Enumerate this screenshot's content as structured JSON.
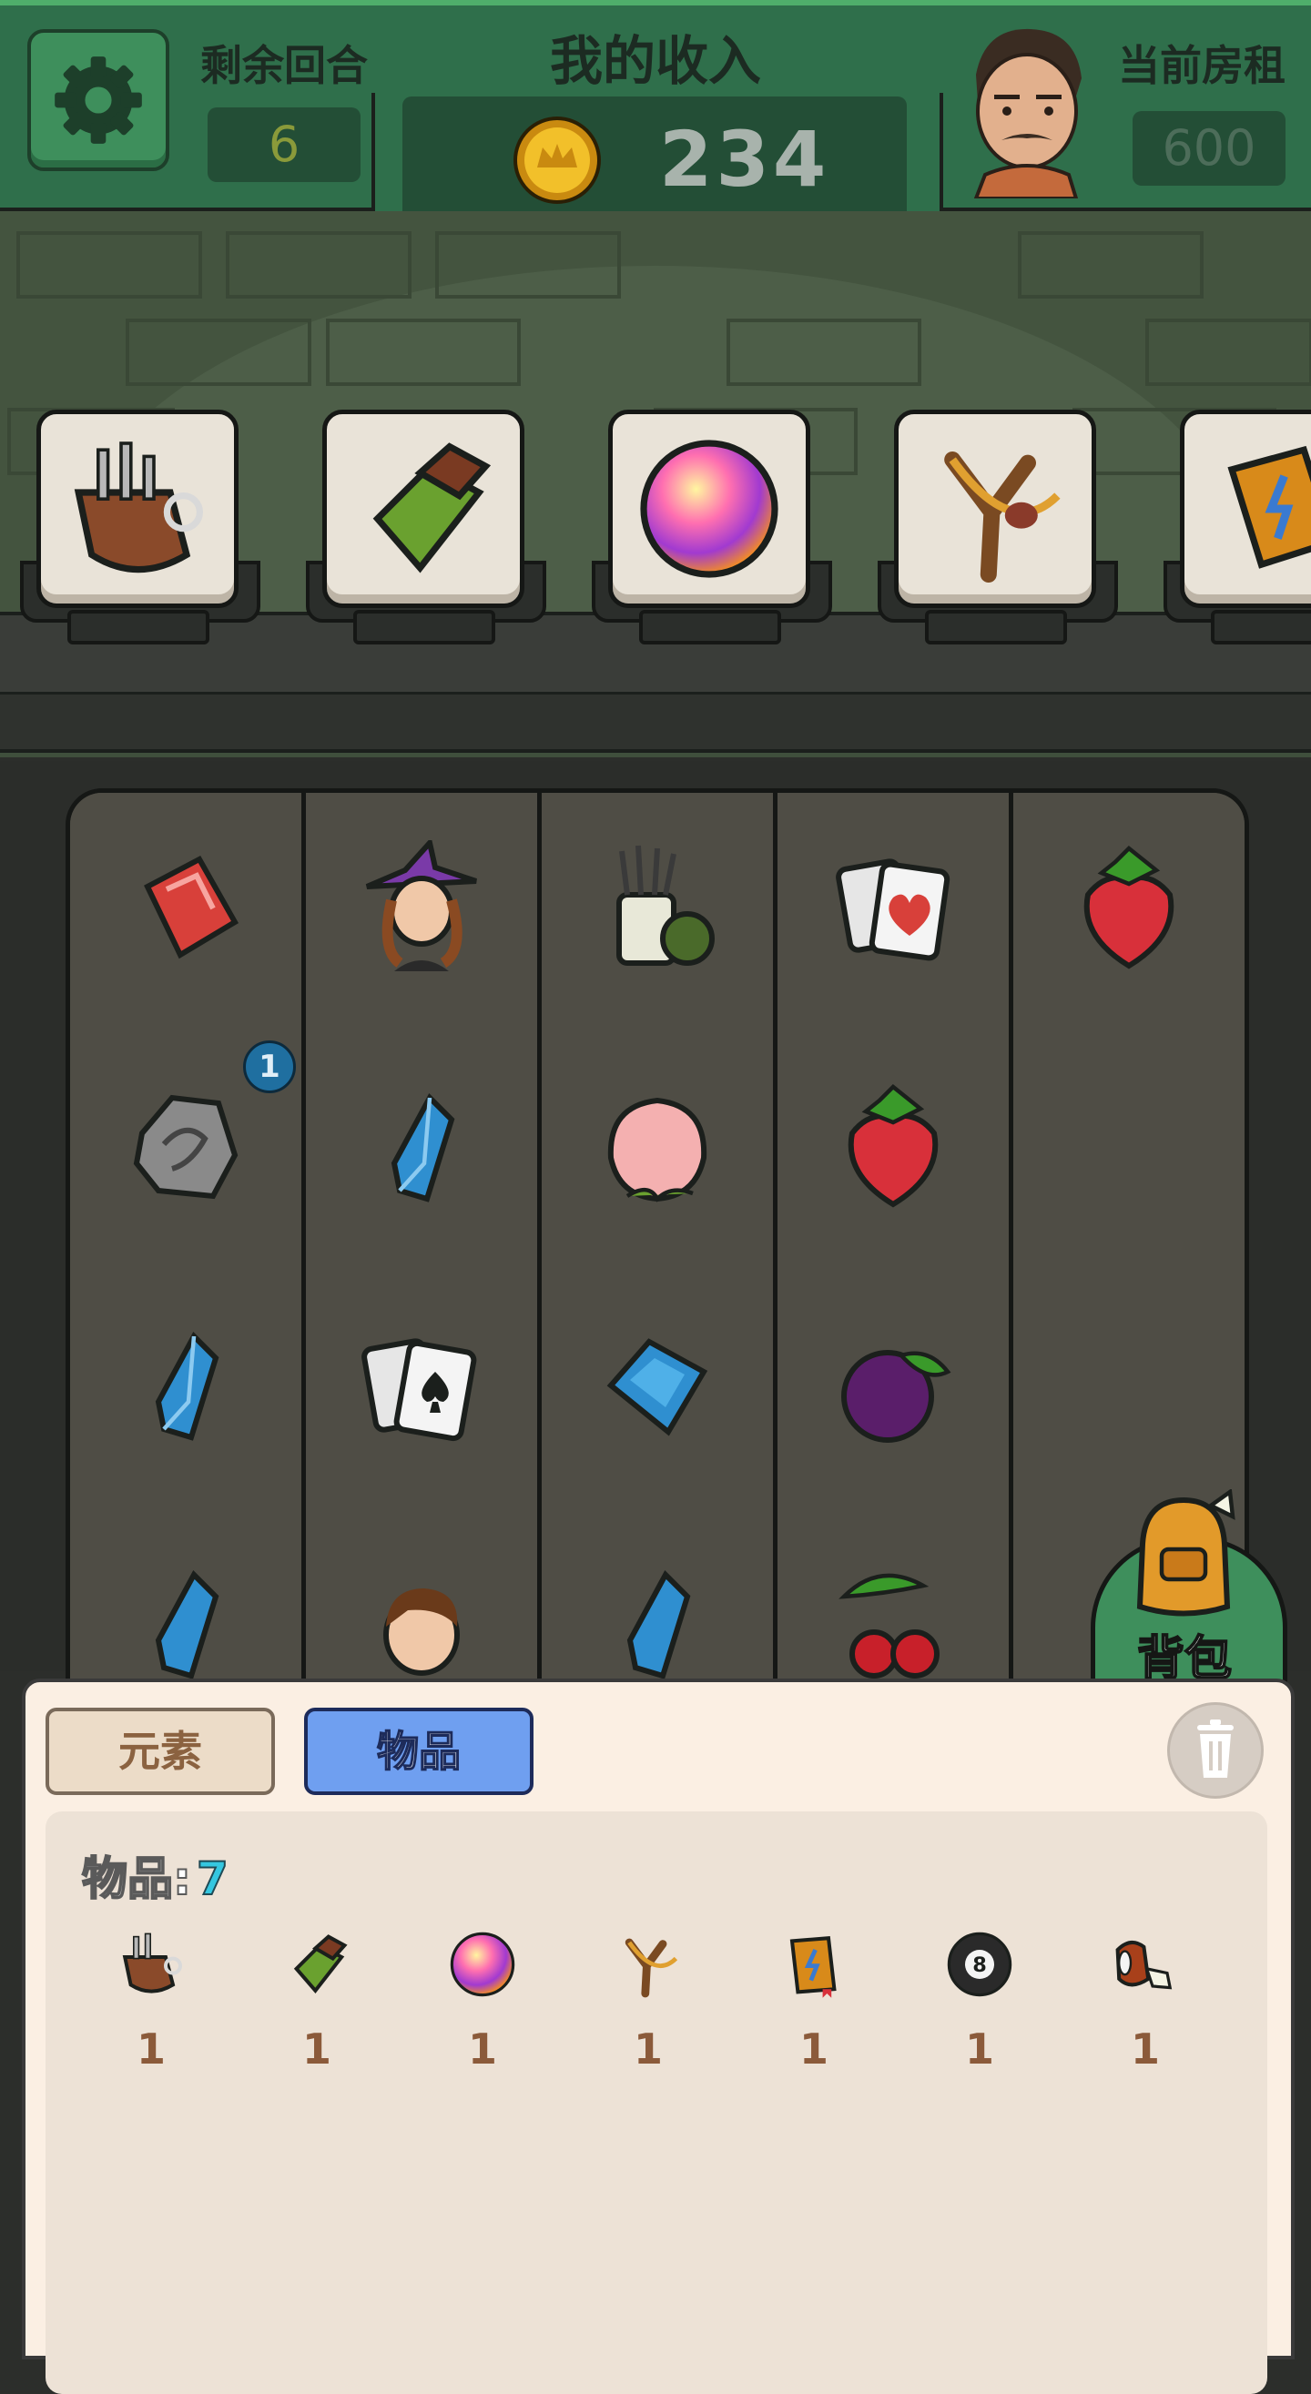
{
  "header": {
    "rounds_label": "剩余回合",
    "rounds_value": "6",
    "income_title": "我的收入",
    "income_value": "234",
    "rent_label": "当前房租",
    "rent_value": "600"
  },
  "shop": {
    "items": [
      {
        "icon": "toolbelt-icon"
      },
      {
        "icon": "chocolate-icon"
      },
      {
        "icon": "rainbow-orb-icon"
      },
      {
        "icon": "slingshot-icon"
      },
      {
        "icon": "spellbook-icon"
      }
    ]
  },
  "board": {
    "columns": [
      [
        "ruby-gem-icon",
        "dragon-stone-icon",
        "blue-crystal-icon",
        "blue-crystal-icon"
      ],
      [
        "witch-icon",
        "blue-crystal-icon",
        "playing-cards-spade-icon",
        "boy-icon"
      ],
      [
        "brush-pot-icon",
        "peach-icon",
        "blue-gem-icon",
        "blue-crystal-icon"
      ],
      [
        "playing-cards-heart-icon",
        "strawberry-icon",
        "plum-icon",
        "cherries-icon"
      ],
      [
        "strawberry-icon",
        "",
        "",
        ""
      ]
    ],
    "badge_value": "1"
  },
  "backpack": {
    "label": "背包"
  },
  "inventory": {
    "tabs": [
      "元素",
      "物品"
    ],
    "active_tab": "物品",
    "count_label": "物品:",
    "count_value": "7",
    "items": [
      {
        "icon": "toolbelt-icon",
        "count": "1"
      },
      {
        "icon": "chocolate-icon",
        "count": "1"
      },
      {
        "icon": "rainbow-orb-icon",
        "count": "1"
      },
      {
        "icon": "slingshot-icon",
        "count": "1"
      },
      {
        "icon": "spellbook-icon",
        "count": "1"
      },
      {
        "icon": "eight-ball-icon",
        "count": "1"
      },
      {
        "icon": "meat-icon",
        "count": "1"
      }
    ]
  },
  "colors": {
    "header_green": "#2f6f4b",
    "accent_blue": "#6f9ff0",
    "panel_bg": "#fbefe3"
  }
}
